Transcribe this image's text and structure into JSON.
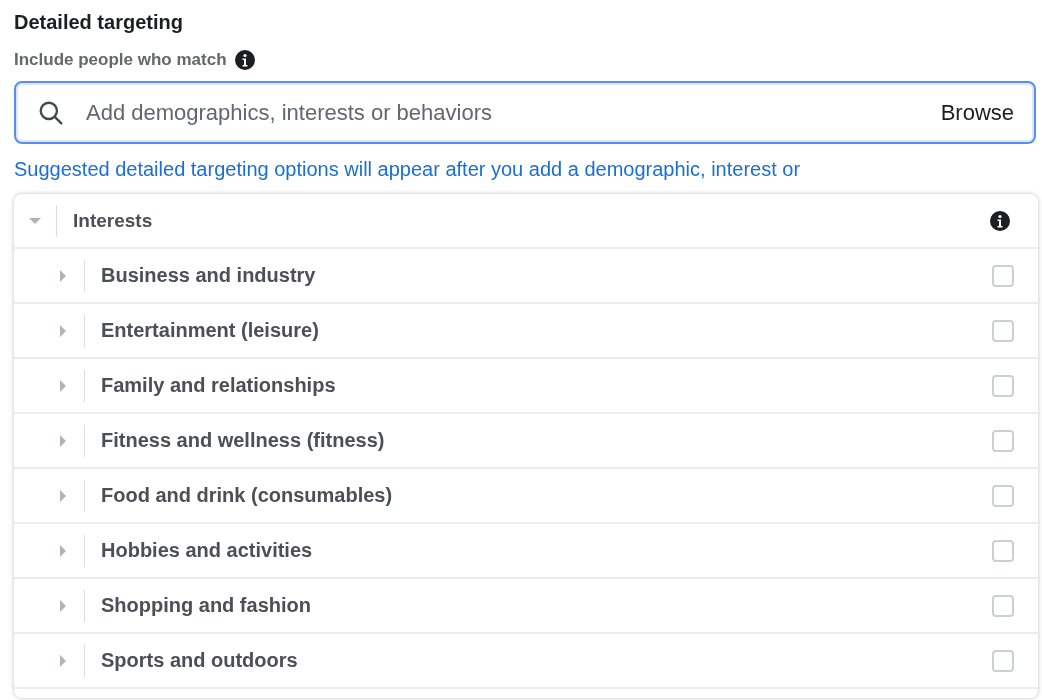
{
  "section": {
    "title": "Detailed targeting",
    "subtitle": "Include people who match"
  },
  "search": {
    "placeholder": "Add demographics, interests or behaviors",
    "browse": "Browse"
  },
  "hint": "Suggested detailed targeting options will appear after you add a demographic, interest or",
  "dropdown": {
    "header": {
      "label": "Interests",
      "expanded": true
    },
    "items": [
      {
        "label": "Business and industry",
        "expanded": false,
        "checked": false
      },
      {
        "label": "Entertainment (leisure)",
        "expanded": false,
        "checked": false
      },
      {
        "label": "Family and relationships",
        "expanded": false,
        "checked": false
      },
      {
        "label": "Fitness and wellness (fitness)",
        "expanded": false,
        "checked": false
      },
      {
        "label": "Food and drink (consumables)",
        "expanded": false,
        "checked": false
      },
      {
        "label": "Hobbies and activities",
        "expanded": false,
        "checked": false
      },
      {
        "label": "Shopping and fashion",
        "expanded": false,
        "checked": false
      },
      {
        "label": "Sports and outdoors",
        "expanded": false,
        "checked": false
      }
    ]
  }
}
